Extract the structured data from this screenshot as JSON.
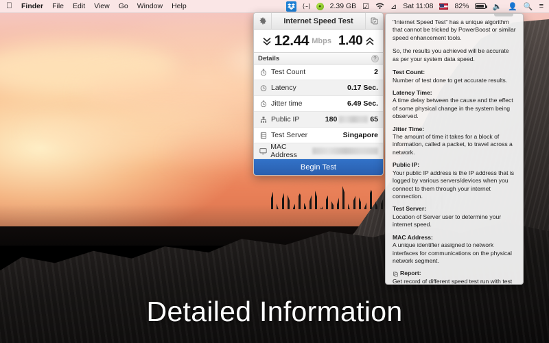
{
  "menubar": {
    "apple_icon": "apple-logo",
    "items": [
      {
        "label": "Finder",
        "bold": true
      },
      {
        "label": "File",
        "bold": false
      },
      {
        "label": "Edit",
        "bold": false
      },
      {
        "label": "View",
        "bold": false
      },
      {
        "label": "Go",
        "bold": false
      },
      {
        "label": "Window",
        "bold": false
      },
      {
        "label": "Help",
        "bold": false
      }
    ],
    "status": {
      "dropbox_icon": "dropbox-icon",
      "ellipsis_icon": "bluetooth-share-icon",
      "green_icon": "app-status-icon",
      "memory": "2.39 GB",
      "check_icon": "checkmark-circle-icon",
      "wifi_icon": "wifi-icon",
      "bluetooth_icon": "bluetooth-icon",
      "clock": "Sat 11:08",
      "flag_icon": "us-flag-icon",
      "battery_percent": "82%",
      "battery_icon": "battery-charging-icon",
      "volume_icon": "volume-icon",
      "user_icon": "user-icon",
      "search_icon": "spotlight-search-icon",
      "notifications_icon": "notification-center-icon"
    }
  },
  "app": {
    "title": "Internet Speed Test",
    "settings_icon": "gear-icon",
    "report_icon": "report-document-icon",
    "speed": {
      "download_icon": "chevron-double-down-icon",
      "download": "12.44",
      "unit": "Mbps",
      "upload": "1.40",
      "upload_icon": "chevron-double-up-icon"
    },
    "details_header": "Details",
    "help_icon": "?",
    "rows": [
      {
        "icon": "stopwatch-icon",
        "label": "Test Count",
        "value": "2",
        "blurred": false
      },
      {
        "icon": "clock-icon",
        "label": "Latency",
        "value": "0.17 Sec.",
        "blurred": false
      },
      {
        "icon": "stopwatch-icon",
        "label": "Jitter time",
        "value": "6.49 Sec.",
        "blurred": false
      },
      {
        "icon": "network-node-icon",
        "label": "Public IP",
        "value": "180",
        "value_suffix": "65",
        "blurred": true
      },
      {
        "icon": "server-rack-icon",
        "label": "Test Server",
        "value": "Singapore",
        "blurred": false
      },
      {
        "icon": "monitor-icon",
        "label": "MAC Address",
        "value": "",
        "blurred": true
      }
    ],
    "begin_button": "Begin Test"
  },
  "popover": {
    "intro1": "\"Internet Speed Test\" has a unique algorithm that cannot be tricked by PowerBoost or similar speed enhancement tools.",
    "intro2": "So, the results you achieved will be accurate as per your system data speed.",
    "sections": [
      {
        "heading": "Test Count:",
        "body": "Number of test done to get accurate results.",
        "icon": null
      },
      {
        "heading": "Latency Time:",
        "body": "A time delay between the cause and the effect of some physical change in the system being observed.",
        "icon": null
      },
      {
        "heading": "Jitter Time:",
        "body": "The amount of time it takes for a block of information, called a packet, to travel across a network.",
        "icon": null
      },
      {
        "heading": "Public IP:",
        "body": "Your public IP address is the IP address that is logged by various servers/devices when you connect to them through your internet connection.",
        "icon": null
      },
      {
        "heading": "Test Server:",
        "body": "Location of Server user to determine your internet speed.",
        "icon": null
      },
      {
        "heading": "MAC Address:",
        "body": "A unique identifier assigned to network interfaces for communications on the physical network segment.",
        "icon": null
      },
      {
        "heading": "Report:",
        "body": "Get record of different speed test run with test time, date, speed and other details.",
        "icon": "report-document-icon"
      }
    ]
  },
  "caption": "Detailed Information",
  "colors": {
    "accent_blue": "#2a5fae",
    "panel_bg": "#ffffff",
    "popover_bg": "#f3f3f3",
    "sky_top": "#f3c7c9",
    "sky_bottom": "#d9764f"
  }
}
